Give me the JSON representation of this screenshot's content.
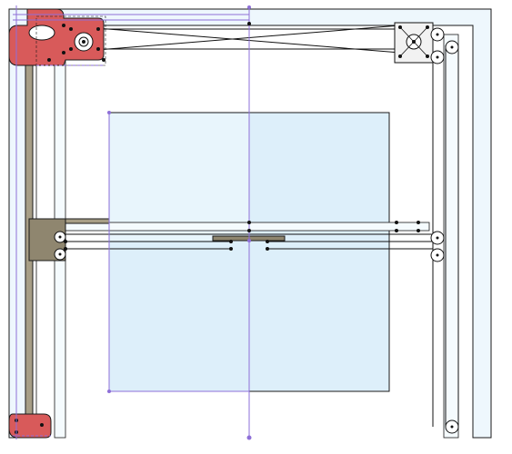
{
  "colors": {
    "frame_fill": "#eef7fd",
    "bed_fill": "#ddeffa",
    "motor_mount": "#d85a5a",
    "rail": "#a79e86",
    "carriage": "#8f866f",
    "guide": "#8e6fd8"
  },
  "parts": [
    "outer-frame",
    "print-bed",
    "top-left-motor-mount",
    "bottom-left-idler-mount",
    "top-right-idler-block",
    "left-rail",
    "x-carriage",
    "belt-lines",
    "pulleys",
    "construction-guides"
  ]
}
